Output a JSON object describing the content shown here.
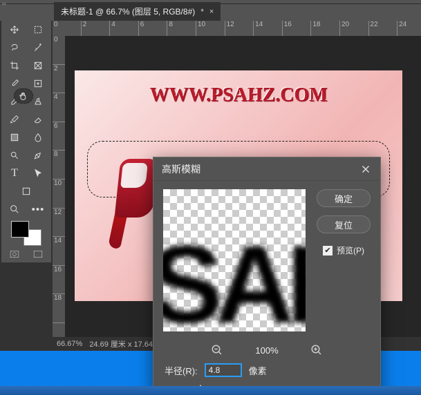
{
  "topedge": "‹‹",
  "tab": {
    "title": "未标题-1 @ 66.7% (图层 5, RGB/8#)",
    "modified": "*",
    "close": "×"
  },
  "ruler_h": [
    "0",
    "2",
    "4",
    "6",
    "8",
    "10",
    "12",
    "14",
    "16",
    "18",
    "20",
    "22",
    "24"
  ],
  "ruler_v": [
    "0",
    "2",
    "4",
    "6",
    "8",
    "10",
    "12",
    "14",
    "16",
    "18"
  ],
  "canvas": {
    "watermark": "WWW.PSAHZ.COM",
    "letter_preview": "SAH"
  },
  "dialog": {
    "title": "高斯模糊",
    "ok": "确定",
    "reset": "复位",
    "preview_label": "预览(P)",
    "preview_checked": true,
    "zoom": "100%",
    "radius_label": "半径(R):",
    "radius_value": "4.8",
    "unit": "像素"
  },
  "status": {
    "zoom": "66.67%",
    "docsize": "24.69 厘米 x 17.64"
  }
}
